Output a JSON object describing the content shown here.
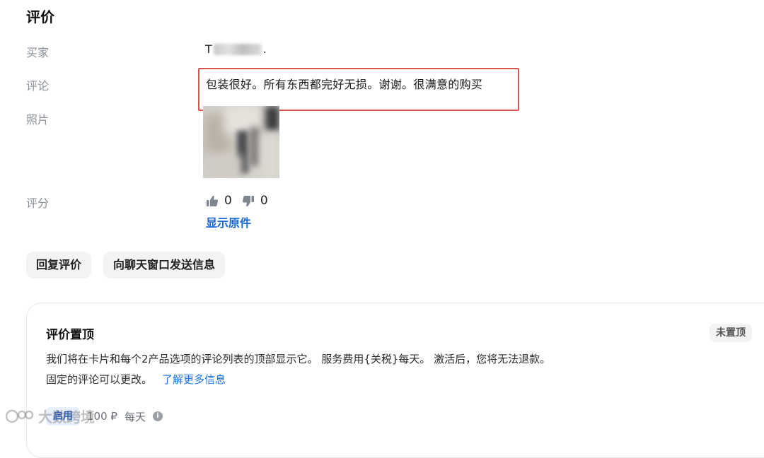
{
  "section_title": "评价",
  "labels": {
    "buyer": "买家",
    "comment": "评论",
    "photos": "照片",
    "rating": "评分"
  },
  "buyer": {
    "initial": "T",
    "suffix": "."
  },
  "comment_text": "包装很好。所有东西都完好无损。谢谢。很满意的购买",
  "rating": {
    "likes": "0",
    "dislikes": "0",
    "show_original": "显示原件"
  },
  "buttons": {
    "reply_review": "回复评价",
    "send_chat": "向聊天窗口发送信息"
  },
  "pin_card": {
    "title": "评价置顶",
    "status_badge": "未置顶",
    "description_line1": "我们将在卡片和每个2产品选项的评论列表的顶部显示它。 服务费用{关税}每天。 激活后，您将无法退款。",
    "description_line2": "固定的评论可以更改。",
    "learn_more": "了解更多信息",
    "price_chip": "启用",
    "price": "100 ₽",
    "period": "每天"
  },
  "watermark_text": "大数跨境",
  "colors": {
    "link_blue": "#1967d2",
    "highlight_red": "#d9534f",
    "label_gray": "#8a8f98",
    "button_bg": "#f2f3f5"
  },
  "icons": {
    "like": "thumbs-up-icon",
    "dislike": "thumbs-down-icon",
    "info": "info-icon"
  }
}
